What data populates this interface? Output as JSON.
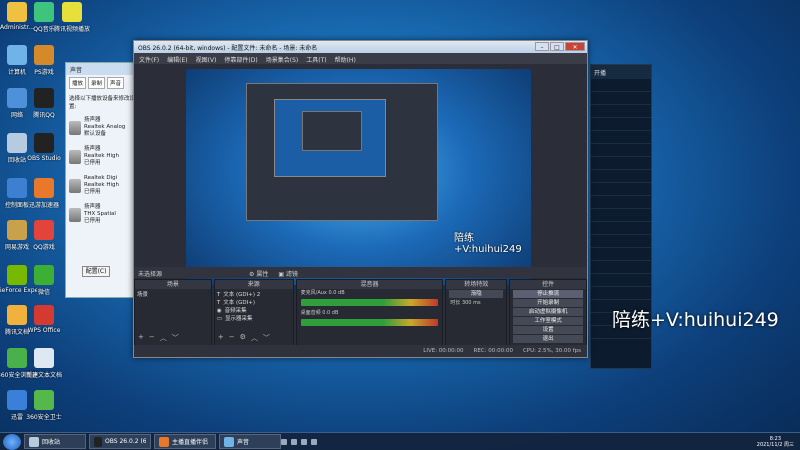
{
  "desktop_icons": [
    {
      "label": "Administr...",
      "color": "#f0c040"
    },
    {
      "label": "QQ音乐",
      "color": "#3fc47e"
    },
    {
      "label": "腾讯视频播放",
      "color": "#e8e03a"
    },
    {
      "label": "计算机",
      "color": "#6fb3e8"
    },
    {
      "label": "PS游戏",
      "color": "#d48a2a"
    },
    {
      "label": "网络",
      "color": "#4e91d8"
    },
    {
      "label": "腾讯QQ",
      "color": "#222222"
    },
    {
      "label": "回收站",
      "color": "#b6cbe0"
    },
    {
      "label": "OBS Studio",
      "color": "#222222"
    },
    {
      "label": "控制面板",
      "color": "#3d7fd1"
    },
    {
      "label": "迅游加速器",
      "color": "#e8792a"
    },
    {
      "label": "网易游戏",
      "color": "#c8a14a"
    },
    {
      "label": "QQ游戏",
      "color": "#e2443b"
    },
    {
      "label": "GeForce Experience",
      "color": "#76b900"
    },
    {
      "label": "微信",
      "color": "#3cb034"
    },
    {
      "label": "腾讯文档",
      "color": "#f0b23c"
    },
    {
      "label": "WPS Office",
      "color": "#d43a2f"
    },
    {
      "label": "360安全浏览器",
      "color": "#4ab04a"
    },
    {
      "label": "新建文本文档",
      "color": "#dde8f3"
    },
    {
      "label": "迅雷",
      "color": "#3a7fd8"
    },
    {
      "label": "360安全卫士",
      "color": "#56b84a"
    }
  ],
  "sound_dialog": {
    "title": "声音",
    "tabs": [
      "播放",
      "录制",
      "声音",
      "通信"
    ],
    "hint": "选择以下播放设备来修改设置:",
    "devices": [
      {
        "name": "扬声器",
        "sub": "Realtek Analog",
        "state": "默认设备"
      },
      {
        "name": "扬声器",
        "sub": "Realtek High",
        "state": "已停用"
      },
      {
        "name": "Realtek Digi",
        "sub": "Realtek High",
        "state": "已停用"
      },
      {
        "name": "扬声器",
        "sub": "THX Spatial",
        "state": "已停用"
      }
    ],
    "configure": "配置(C)"
  },
  "obs": {
    "title": "OBS 26.0.2 (64-bit, windows) - 配置文件: 未命名 - 场景: 未命名",
    "menu": [
      "文件(F)",
      "编辑(E)",
      "视图(V)",
      "停靠部件(D)",
      "场景集合(S)",
      "工具(T)",
      "帮助(H)"
    ],
    "no_source": "未选择源",
    "scene_tabs": [
      "属性",
      "滤镜"
    ],
    "docks": {
      "scenes": {
        "title": "场景",
        "items": [
          "场景"
        ]
      },
      "sources": {
        "title": "来源",
        "items": [
          "文本 (GDI+) 2",
          "文本 (GDI+)",
          "音频采集",
          "显示器采集"
        ]
      },
      "mixer": {
        "title": "混音器",
        "tracks": [
          {
            "name": "麦克风/Aux",
            "db": "0.0 dB"
          },
          {
            "name": "桌面音频",
            "db": "0.0 dB"
          }
        ]
      },
      "transitions": {
        "title": "转场特效",
        "fade": "渐隐",
        "duration_label": "时长",
        "duration": "300 ms"
      },
      "controls": {
        "title": "控件",
        "buttons": [
          "停止推流",
          "开始录制",
          "启动虚拟摄像机",
          "工作室模式",
          "设置",
          "退出"
        ]
      }
    },
    "status": [
      "LIVE: 00:00:00",
      "REC: 00:00:00",
      "CPU: 2.5%, 30.00 fps"
    ]
  },
  "preview": {
    "watermark": "陪练+V:huihui249"
  },
  "watermark": "陪练+V:huihui249",
  "right_window": {
    "title": "开播"
  },
  "taskbar": {
    "buttons": [
      {
        "label": "回收站",
        "color": "#b6cbe0"
      },
      {
        "label": "OBS 26.0.2 (64...",
        "color": "#222222"
      },
      {
        "label": "主播直播伴侣",
        "color": "#e8792a"
      },
      {
        "label": "声音",
        "color": "#6fb3e8"
      }
    ],
    "time": "8:23",
    "date": "2021/11/2 周三"
  }
}
